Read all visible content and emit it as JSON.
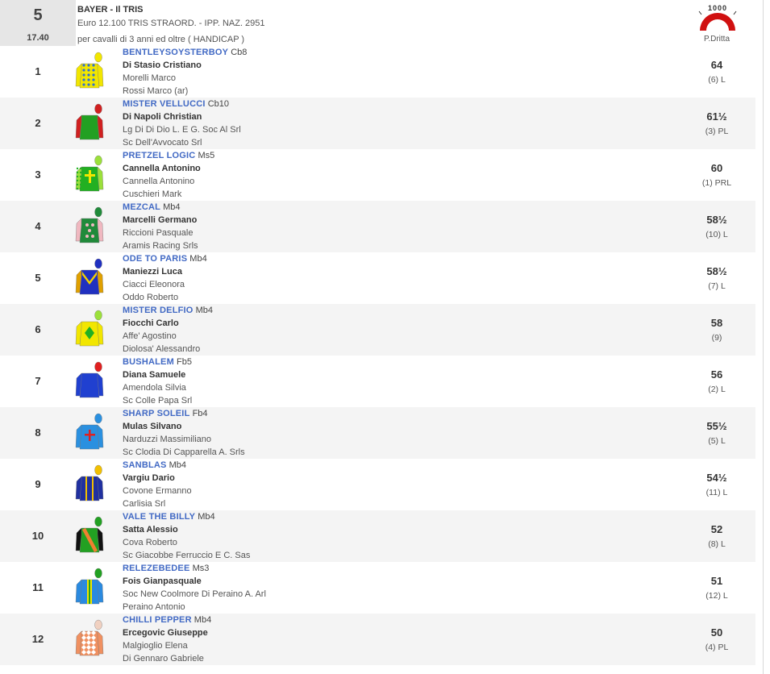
{
  "race": {
    "number": "5",
    "time": "17.40",
    "name": "BAYER - Il TRIS",
    "prize": "Euro 12.100 TRIS STRAORD. - IPP. NAZ. 2951",
    "conditions": "per cavalli di 3 anni ed oltre ( HANDICAP )",
    "distance_badge": "1000",
    "track_side": "P.Dritta",
    "track_icon": "track-turn-icon",
    "badge_color": "#d01010"
  },
  "runners": [
    {
      "num": "1",
      "horse": "BENTLEYSOYSTERBOY",
      "eq": "Cb8",
      "jockey": "Di Stasio Cristiano",
      "trainer": "Morelli Marco",
      "owner": "Rossi Marco (ar)",
      "weight": "64",
      "draw": "(6) L",
      "silk": {
        "body": "#f2e600",
        "sleeve": "#f2e600",
        "cap": "#f2e600",
        "accent": "#3070d0",
        "pattern": "dots"
      }
    },
    {
      "num": "2",
      "horse": "MISTER VELLUCCI",
      "eq": "Cb10",
      "jockey": "Di Napoli Christian",
      "trainer": "Lg Di Di Dio L. E G. Soc Al Srl",
      "owner": "Sc Dell'Avvocato Srl",
      "weight": "61½",
      "draw": "(3) PL",
      "silk": {
        "body": "#22a022",
        "sleeve": "#d02020",
        "cap": "#d02020",
        "accent": "#ffffff",
        "pattern": "checks"
      }
    },
    {
      "num": "3",
      "horse": "PRETZEL LOGIC",
      "eq": "Ms5",
      "jockey": "Cannella Antonino",
      "trainer": "Cannella Antonino",
      "owner": "Cuschieri Mark",
      "weight": "60",
      "draw": "(1) PRL",
      "silk": {
        "body": "#22b022",
        "sleeve": "#9be03a",
        "cap": "#9be03a",
        "accent": "#f2e600",
        "pattern": "cross"
      }
    },
    {
      "num": "4",
      "horse": "MEZCAL",
      "eq": "Mb4",
      "jockey": "Marcelli Germano",
      "trainer": "Riccioni Pasquale",
      "owner": "Aramis Racing Srls",
      "weight": "58½",
      "draw": "(10) L",
      "silk": {
        "body": "#208a3a",
        "sleeve": "#f0b8c0",
        "cap": "#208a3a",
        "accent": "#f0b8c0",
        "pattern": "spots"
      }
    },
    {
      "num": "5",
      "horse": "ODE TO PARIS",
      "eq": "Mb4",
      "jockey": "Maniezzi Luca",
      "trainer": "Ciacci Eleonora",
      "owner": "Oddo Roberto",
      "weight": "58½",
      "draw": "(7) L",
      "silk": {
        "body": "#2030c0",
        "sleeve": "#e0a000",
        "cap": "#2030c0",
        "accent": "#f2d000",
        "pattern": "chevron"
      }
    },
    {
      "num": "6",
      "horse": "MISTER DELFIO",
      "eq": "Mb4",
      "jockey": "Fiocchi Carlo",
      "trainer": "Affe' Agostino",
      "owner": "Diolosa' Alessandro",
      "weight": "58",
      "draw": "(9)",
      "silk": {
        "body": "#f2e600",
        "sleeve": "#f2e600",
        "cap": "#9be03a",
        "accent": "#22b022",
        "pattern": "diamond"
      }
    },
    {
      "num": "7",
      "horse": "BUSHALEM",
      "eq": "Fb5",
      "jockey": "Diana Samuele",
      "trainer": "Amendola Silvia",
      "owner": "Sc Colle Papa Srl",
      "weight": "56",
      "draw": "(2) L",
      "silk": {
        "body": "#2040d0",
        "sleeve": "#2040d0",
        "cap": "#e02020",
        "accent": "#ffffff",
        "pattern": "checks"
      }
    },
    {
      "num": "8",
      "horse": "SHARP SOLEIL",
      "eq": "Fb4",
      "jockey": "Mulas Silvano",
      "trainer": "Narduzzi Massimiliano",
      "owner": "Sc Clodia Di Capparella A. Srls",
      "weight": "55½",
      "draw": "(5) L",
      "silk": {
        "body": "#2a90e0",
        "sleeve": "#2a90e0",
        "cap": "#2a90e0",
        "accent": "#e02020",
        "pattern": "cross-red"
      }
    },
    {
      "num": "9",
      "horse": "SANBLAS",
      "eq": "Mb4",
      "jockey": "Vargiu Dario",
      "trainer": "Covone Ermanno",
      "owner": "Carlisia Srl",
      "weight": "54½",
      "draw": "(11) L",
      "silk": {
        "body": "#2030a0",
        "sleeve": "#2030a0",
        "cap": "#f2c000",
        "accent": "#f2c000",
        "pattern": "stripes"
      }
    },
    {
      "num": "10",
      "horse": "VALE THE BILLY",
      "eq": "Mb4",
      "jockey": "Satta Alessio",
      "trainer": "Cova Roberto",
      "owner": "Sc Giacobbe Ferruccio E C. Sas",
      "weight": "52",
      "draw": "(8) L",
      "silk": {
        "body": "#22a022",
        "sleeve": "#111111",
        "cap": "#22a022",
        "accent": "#f08030",
        "pattern": "sash"
      }
    },
    {
      "num": "11",
      "horse": "RELEZEBEDEE",
      "eq": "Ms3",
      "jockey": "Fois Gianpasquale",
      "trainer": "Soc New Coolmore Di Peraino A. Arl",
      "owner": "Peraino Antonio",
      "weight": "51",
      "draw": "(12) L",
      "silk": {
        "body": "#2a8ae0",
        "sleeve": "#2a8ae0",
        "cap": "#22a022",
        "accent": "#f2e600",
        "pattern": "vstripe"
      }
    },
    {
      "num": "12",
      "horse": "CHILLI PEPPER",
      "eq": "Mb4",
      "jockey": "Ercegovic Giuseppe",
      "trainer": "Malgioglio Elena",
      "owner": "Di Gennaro Gabriele",
      "weight": "50",
      "draw": "(4) PL",
      "silk": {
        "body": "#f09060",
        "sleeve": "#f09060",
        "cap": "#f0d0c0",
        "accent": "#ffffff",
        "pattern": "diamonds"
      }
    }
  ]
}
